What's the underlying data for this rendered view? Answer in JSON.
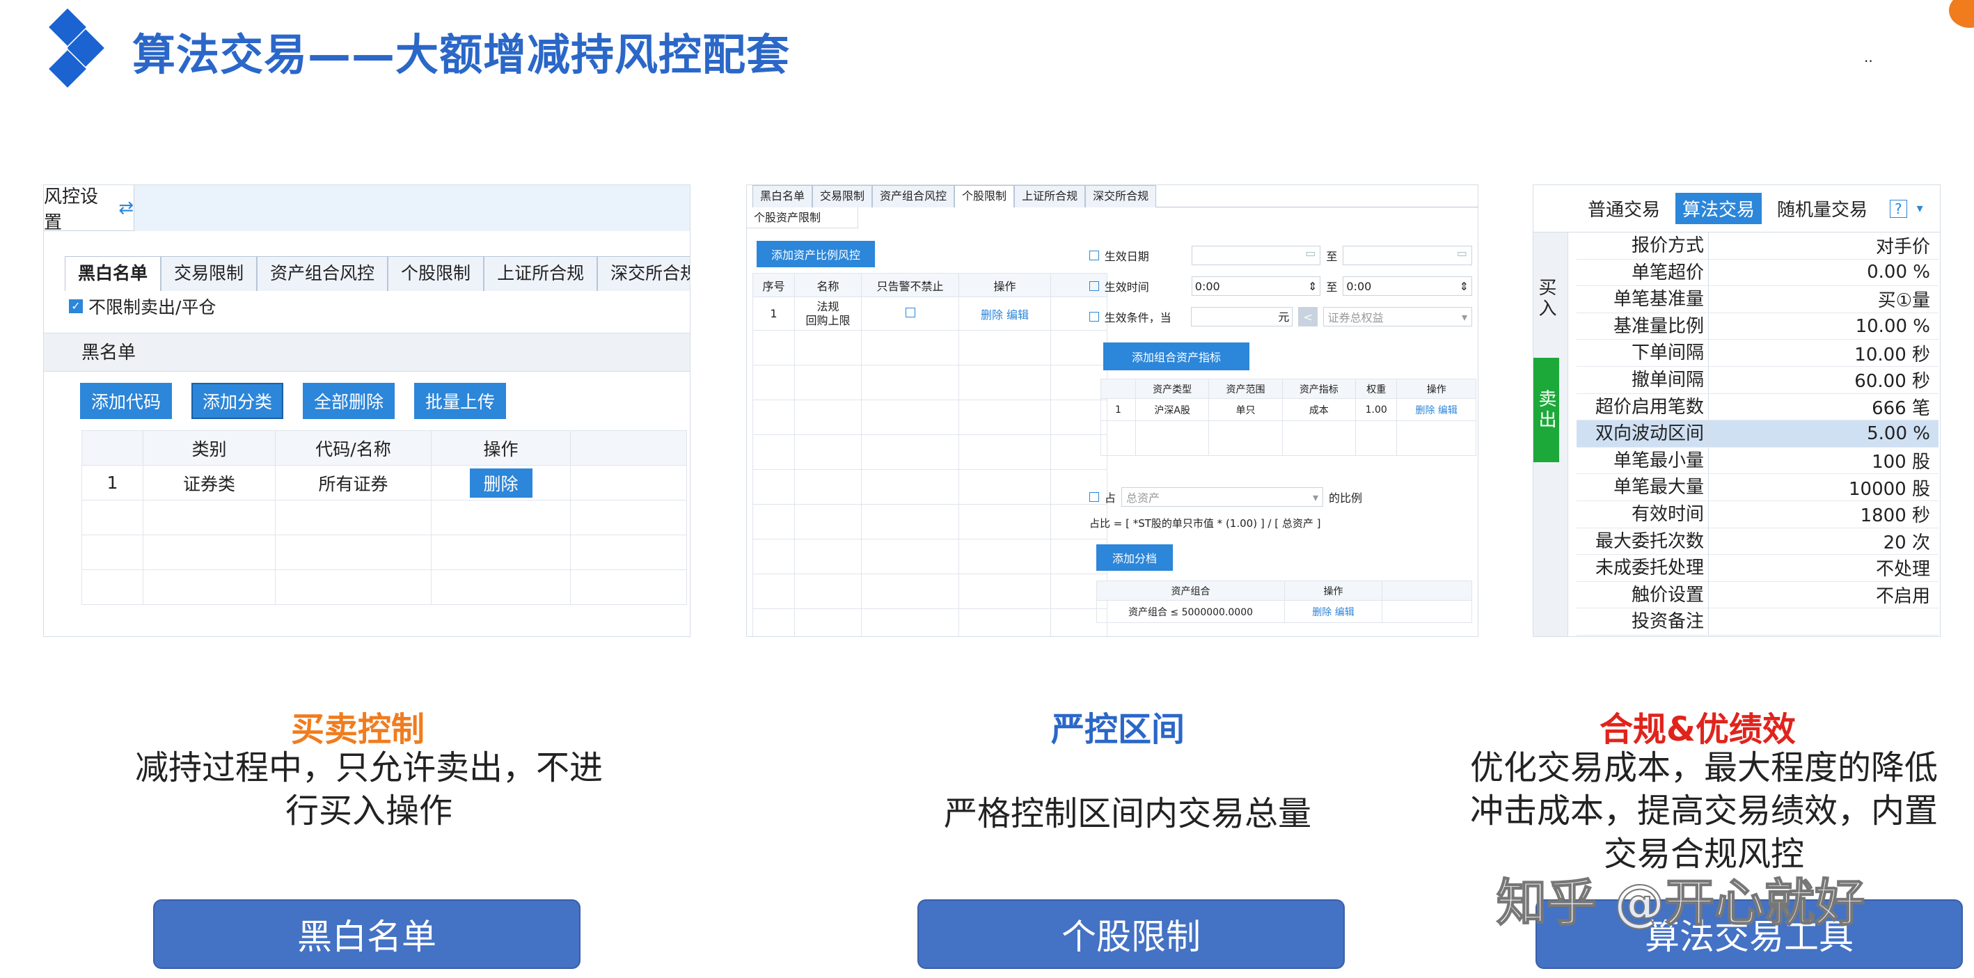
{
  "header": {
    "title": "算法交易——大额增减持风控配套"
  },
  "left_panel": {
    "settings_title": "风控设置",
    "tabs": [
      "黑白名单",
      "交易限制",
      "资产组合风控",
      "个股限制",
      "上证所合规",
      "深交所合规"
    ],
    "checkbox_label": "不限制卖出/平仓",
    "section_title": "黑名单",
    "buttons": [
      "添加代码",
      "添加分类",
      "全部删除",
      "批量上传"
    ],
    "columns": [
      "",
      "类别",
      "代码/名称",
      "操作"
    ],
    "rows": [
      {
        "no": "1",
        "category": "证券类",
        "code": "所有证券",
        "action": "删除"
      }
    ]
  },
  "middle_panel": {
    "tabs": [
      "黑白名单",
      "交易限制",
      "资产组合风控",
      "个股限制",
      "上证所合规",
      "深交所合规"
    ],
    "subtab": "个股资产限制",
    "add_btn": "添加资产比例风控",
    "columns": [
      "序号",
      "名称",
      "只告警不禁止",
      "操作"
    ],
    "row": {
      "no": "1",
      "name_line1": "法规",
      "name_line2": "回购上限",
      "edit": "删除 编辑"
    },
    "effective_date": "生效日期",
    "effective_time": "生效时间",
    "effective_cond": "生效条件，当",
    "to": "至",
    "time_from": "0:00",
    "time_to": "0:00",
    "yuan": "元",
    "lt": "<",
    "cond_select": "证券总权益",
    "add_asset_btn": "添加组合资产指标",
    "asset_columns": [
      "",
      "资产类型",
      "资产范围",
      "资产指标",
      "权重",
      "操作"
    ],
    "asset_row": [
      "1",
      "沪深A股",
      "单只",
      "成本",
      "1.00",
      "删除 编辑"
    ],
    "occupy_label": "占",
    "occupy_select": "总资产",
    "ratio_label": "的比例",
    "formula": "占比 = [ *ST股的单只市值 * (1.00) ] / [ 总资产 ]",
    "add_group_btn": "添加分档",
    "group_columns": [
      "资产组合",
      "操作"
    ],
    "group_row": [
      "资产组合 ≤ 5000000.0000",
      "删除 编辑"
    ]
  },
  "right_panel": {
    "tabs": [
      "普通交易",
      "算法交易",
      "随机量交易"
    ],
    "help": "?",
    "side_buy": "买入",
    "side_sell": "卖出",
    "rows": [
      [
        "报价方式",
        "对手价"
      ],
      [
        "单笔超价",
        "0.00 %"
      ],
      [
        "单笔基准量",
        "买①量"
      ],
      [
        "基准量比例",
        "10.00 %"
      ],
      [
        "下单间隔",
        "10.00 秒"
      ],
      [
        "撤单间隔",
        "60.00 秒"
      ],
      [
        "超价启用笔数",
        "666 笔"
      ],
      [
        "双向波动区间",
        "5.00 %"
      ],
      [
        "单笔最小量",
        "100 股"
      ],
      [
        "单笔最大量",
        "10000 股"
      ],
      [
        "有效时间",
        "1800 秒"
      ],
      [
        "最大委托次数",
        "20 次"
      ],
      [
        "未成委托处理",
        "不处理"
      ],
      [
        "触价设置",
        "不启用"
      ],
      [
        "投资备注",
        ""
      ]
    ]
  },
  "captions": [
    {
      "title": "买卖控制",
      "desc": [
        "减持过程中，只允许卖出，不进",
        "行买入操作"
      ],
      "button": "黑白名单"
    },
    {
      "title": "严控区间",
      "desc": [
        "严格控制区间内交易总量"
      ],
      "button": "个股限制"
    },
    {
      "title": "合规&优绩效",
      "desc": [
        "优化交易成本，最大程度的降低",
        "冲击成本，提高交易绩效，内置",
        "交易合规风控"
      ],
      "button": "算法交易工具"
    }
  ],
  "watermark": "知乎 @开心就好",
  "colors": {
    "title_blue": "#2a67c8",
    "orange": "#f07c1e",
    "red": "#e0241c",
    "button_blue": "#4472c4",
    "ui_blue": "#2c86d9",
    "green": "#1da83a"
  }
}
